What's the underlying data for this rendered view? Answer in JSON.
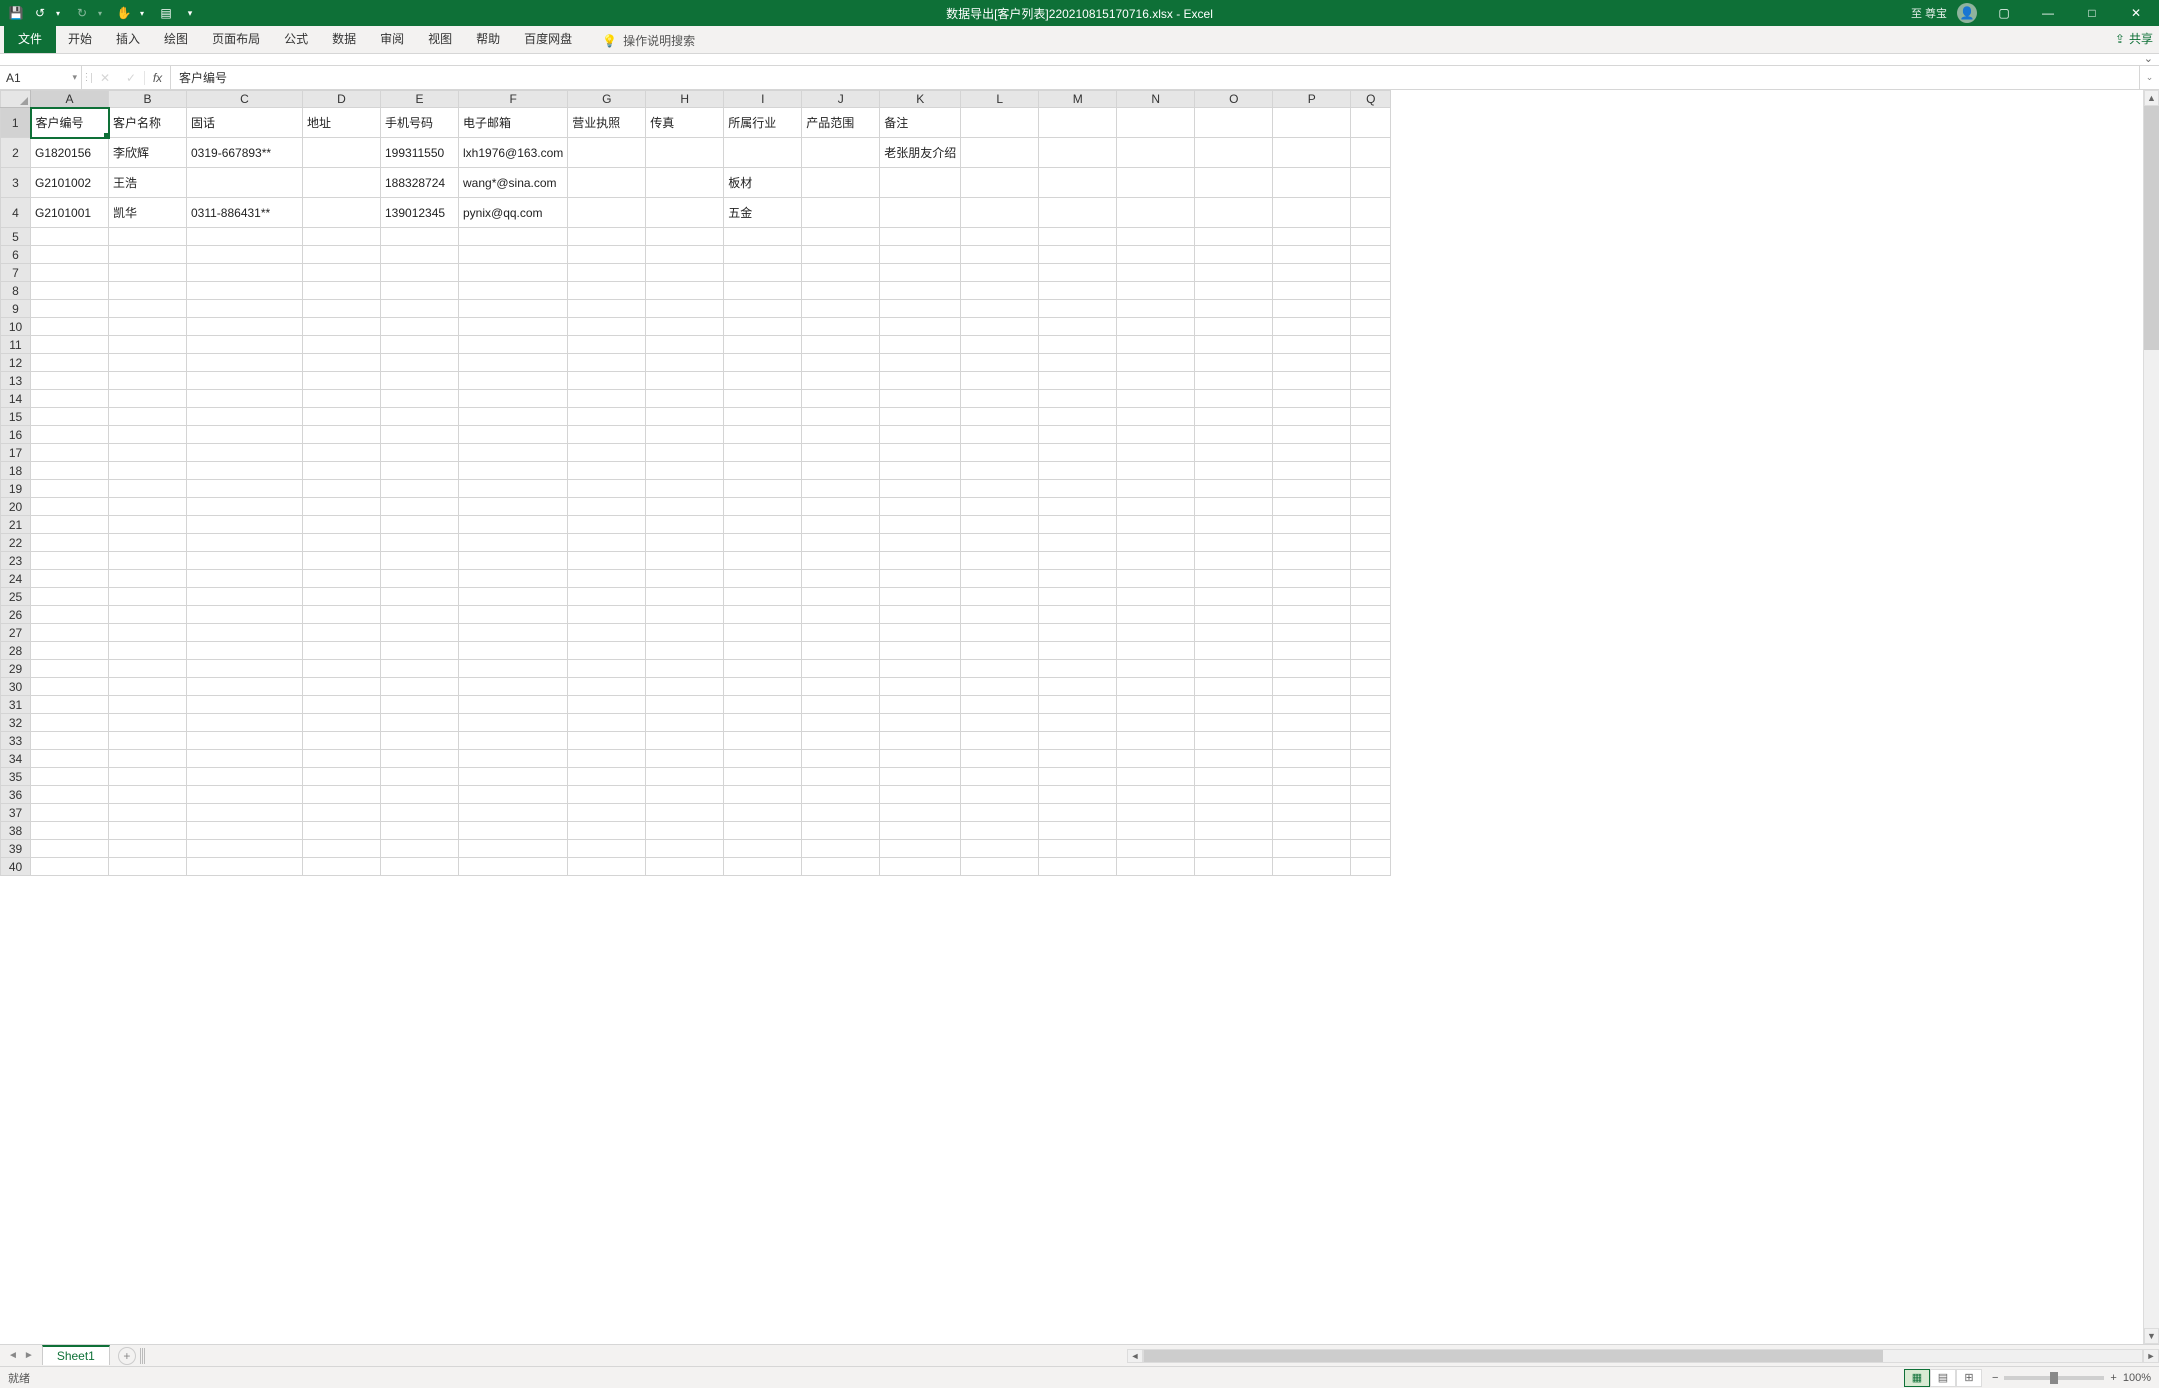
{
  "title": "数据导出[客户列表]220210815170716.xlsx - Excel",
  "account_label": "至 尊宝",
  "ribbon": {
    "file": "文件",
    "tabs": [
      "开始",
      "插入",
      "绘图",
      "页面布局",
      "公式",
      "数据",
      "审阅",
      "视图",
      "帮助",
      "百度网盘"
    ],
    "tell_me": "操作说明搜索",
    "share": "共享"
  },
  "namebox": "A1",
  "fx_label": "fx",
  "formula_value": "客户编号",
  "columns": [
    "A",
    "B",
    "C",
    "D",
    "E",
    "F",
    "G",
    "H",
    "I",
    "J",
    "K",
    "L",
    "M",
    "N",
    "O",
    "P",
    "Q"
  ],
  "headers": {
    "A": "客户编号",
    "B": "客户名称",
    "C": "固话",
    "D": "地址",
    "E": "手机号码",
    "F": "电子邮箱",
    "G": "营业执照",
    "H": "传真",
    "I": "所属行业",
    "J": "产品范围",
    "K": "备注"
  },
  "rows": [
    {
      "A": "G1820156",
      "B": "李欣辉",
      "C": "0319-667893**",
      "D": "",
      "E": "199311550",
      "F": "lxh1976@163.com",
      "G": "",
      "H": "",
      "I": "",
      "J": "",
      "K": "老张朋友介绍"
    },
    {
      "A": "G2101002",
      "B": "王浩",
      "C": "",
      "D": "",
      "E": "188328724",
      "F": "wang*@sina.com",
      "G": "",
      "H": "",
      "I": "板材",
      "J": "",
      "K": ""
    },
    {
      "A": "G2101001",
      "B": "凯华",
      "C": "0311-886431**",
      "D": "",
      "E": "139012345",
      "F": "pynix@qq.com",
      "G": "",
      "H": "",
      "I": "五金",
      "J": "",
      "K": ""
    }
  ],
  "total_rows_visible": 40,
  "sheet_tab": "Sheet1",
  "status_text": "就绪",
  "zoom": "100%"
}
